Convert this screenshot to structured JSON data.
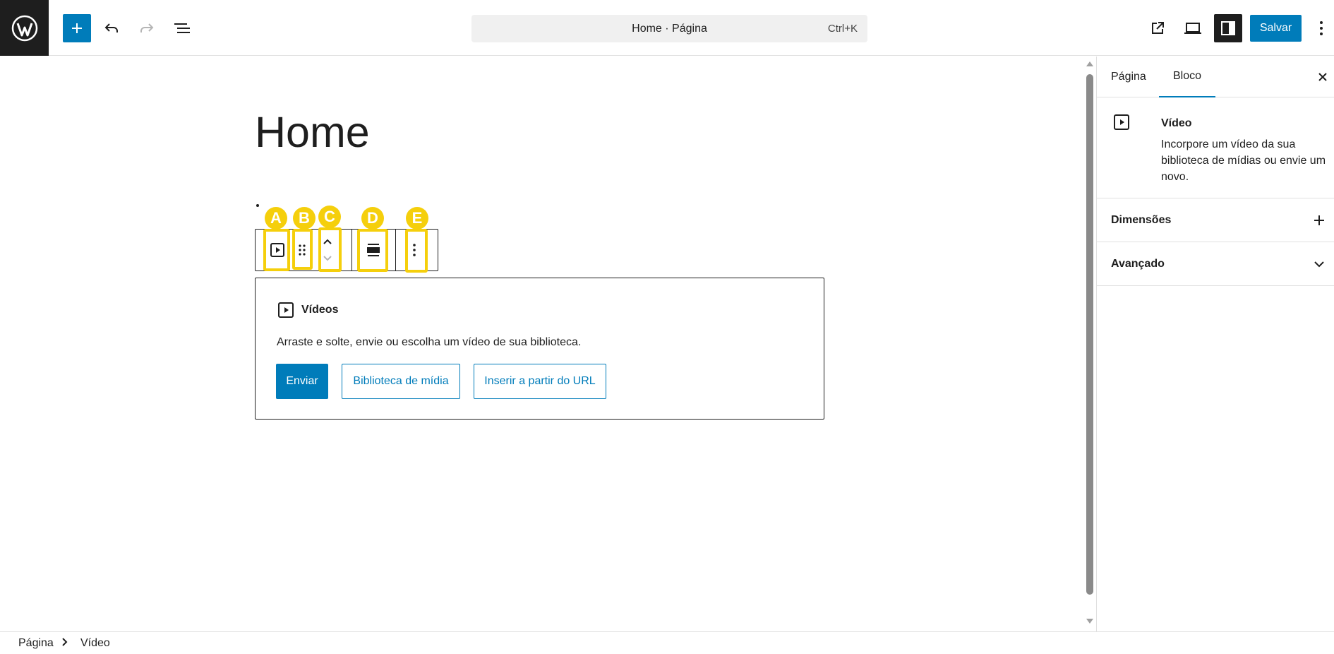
{
  "header": {
    "wp_logo_icon": "wordpress-logo-icon",
    "document_title": "Home · Página",
    "shortcut": "Ctrl+K",
    "save_label": "Salvar",
    "accent_color": "#007cba"
  },
  "editor": {
    "page_title": "Home",
    "video_placeholder": {
      "title": "Vídeos",
      "instructions": "Arraste e solte, envie ou escolha um vídeo de sua biblioteca.",
      "upload_label": "Enviar",
      "library_label": "Biblioteca de mídia",
      "url_label": "Inserir a partir do URL"
    },
    "toolbar_markers": [
      "A",
      "B",
      "C",
      "D",
      "E"
    ],
    "marker_color": "#f5cf0c"
  },
  "sidebar": {
    "tabs": [
      "Página",
      "Bloco"
    ],
    "active_tab": "Bloco",
    "block_card": {
      "title": "Vídeo",
      "description": "Incorpore um vídeo da sua biblioteca de mídias ou envie um novo."
    },
    "panels": [
      "Dimensões",
      "Avançado"
    ]
  },
  "footer": {
    "breadcrumbs": [
      "Página",
      "Vídeo"
    ]
  }
}
